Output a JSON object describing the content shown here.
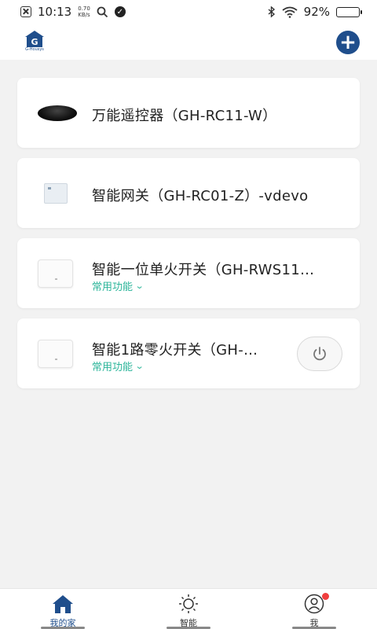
{
  "status_bar": {
    "time": "10:13",
    "net_speed_value": "0.70",
    "net_speed_unit": "KB/s",
    "battery": "92%",
    "battery_level": 0.92
  },
  "header": {
    "logo_letter": "G",
    "logo_text": "G-Housys",
    "add_symbol": "+"
  },
  "devices": [
    {
      "name": "万能遥控器（GH-RC11-W）",
      "image": "ir-remote-image"
    },
    {
      "name": "智能网关（GH-RC01-Z）-vdevo",
      "image": "gateway-image"
    },
    {
      "name": "智能一位单火开关（GH-RWS11…",
      "image": "switch-image",
      "function_label": "常用功能"
    },
    {
      "name": "智能1路零火开关（GH-…",
      "image": "switch-image",
      "function_label": "常用功能",
      "action_icon": "power-icon"
    }
  ],
  "tabs": [
    {
      "label": "我的家",
      "icon": "home-icon",
      "active": true
    },
    {
      "label": "智能",
      "icon": "sun-icon",
      "active": false
    },
    {
      "label": "我",
      "icon": "user-icon",
      "active": false,
      "badge": true
    }
  ],
  "colors": {
    "primary": "#1f4e8c",
    "accent": "#2cb59a",
    "badge": "#f03e3e",
    "background": "#f2f2f2"
  }
}
